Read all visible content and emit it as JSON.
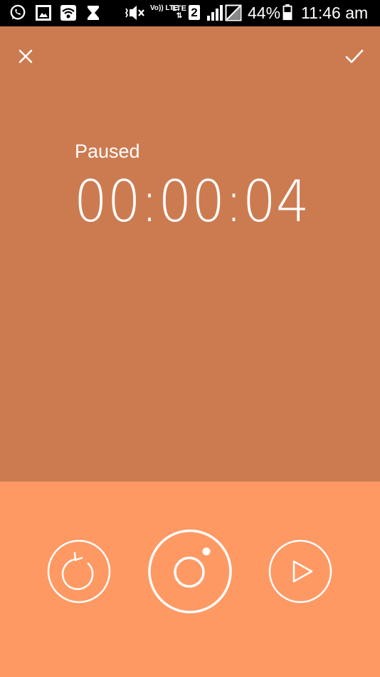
{
  "status_bar": {
    "icons": [
      "whatsapp-icon",
      "gallery-icon",
      "wifi-hotspot-icon",
      "hourglass-icon",
      "vibrate-mute-icon",
      "volte-icon",
      "lte-data-icon",
      "sim-2-icon",
      "signal-icon",
      "no-signal-icon",
      "battery-icon"
    ],
    "volte_label": "Vo)) LTE",
    "lte_label": "LTE",
    "sim_number": "2",
    "battery_percent": "44%",
    "time": "11:46 am"
  },
  "header": {
    "close_icon": "close-icon",
    "confirm_icon": "check-icon"
  },
  "timer": {
    "state_label": "Paused",
    "elapsed": "00:00:04"
  },
  "controls": {
    "reset_icon": "reset-icon",
    "lap_icon": "lap-record-icon",
    "play_icon": "play-icon"
  },
  "colors": {
    "main_background": "#cc7b51",
    "controls_background": "#ff9964",
    "foreground": "#ffffff"
  }
}
